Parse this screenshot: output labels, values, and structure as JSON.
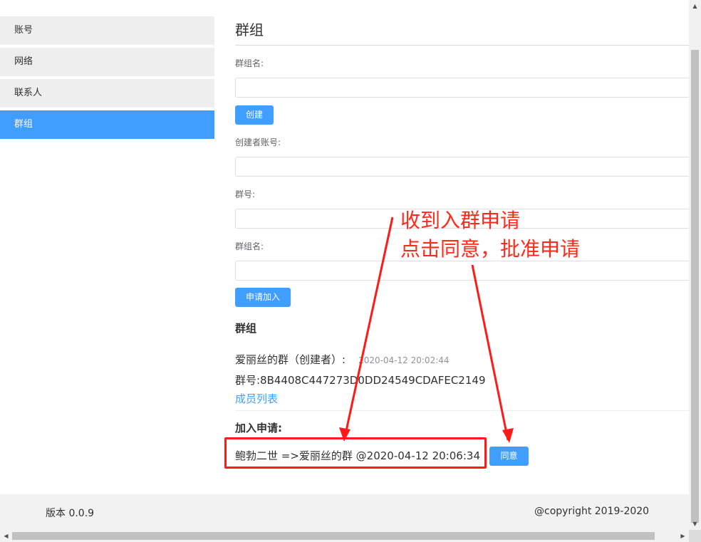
{
  "sidebar": {
    "items": [
      {
        "label": "账号",
        "active": false
      },
      {
        "label": "网络",
        "active": false
      },
      {
        "label": "联系人",
        "active": false
      },
      {
        "label": "群组",
        "active": true
      }
    ]
  },
  "main": {
    "title": "群组",
    "create": {
      "name_label": "群组名:",
      "name_value": "",
      "button_label": "创建"
    },
    "join": {
      "creator_label": "创建者账号:",
      "creator_value": "",
      "group_id_label": "群号:",
      "group_id_value": "",
      "group_name_label": "群组名:",
      "group_name_value": "",
      "button_label": "申请加入"
    },
    "groups": {
      "section_title": "群组",
      "group_line": "爱丽丝的群（创建者）:",
      "group_time": "2020-04-12 20:02:44",
      "group_id_line": "群号:8B4408C447273D0DD24549CDAFEC2149",
      "member_link": "成员列表"
    },
    "requests": {
      "section_title": "加入申请:",
      "request_line": "鲍勃二世 =>爱丽丝的群 @2020-04-12 20:06:34",
      "agree_label": "同意"
    }
  },
  "footer": {
    "version": "版本 0.0.9",
    "copyright": "@copyright 2019-2020"
  },
  "annotation": {
    "line1": "收到入群申请",
    "line2": "点击同意，批准申请",
    "color": "#ff1a1a"
  },
  "colors": {
    "accent": "#409eff",
    "sidebar_bg": "#eeeeee"
  }
}
